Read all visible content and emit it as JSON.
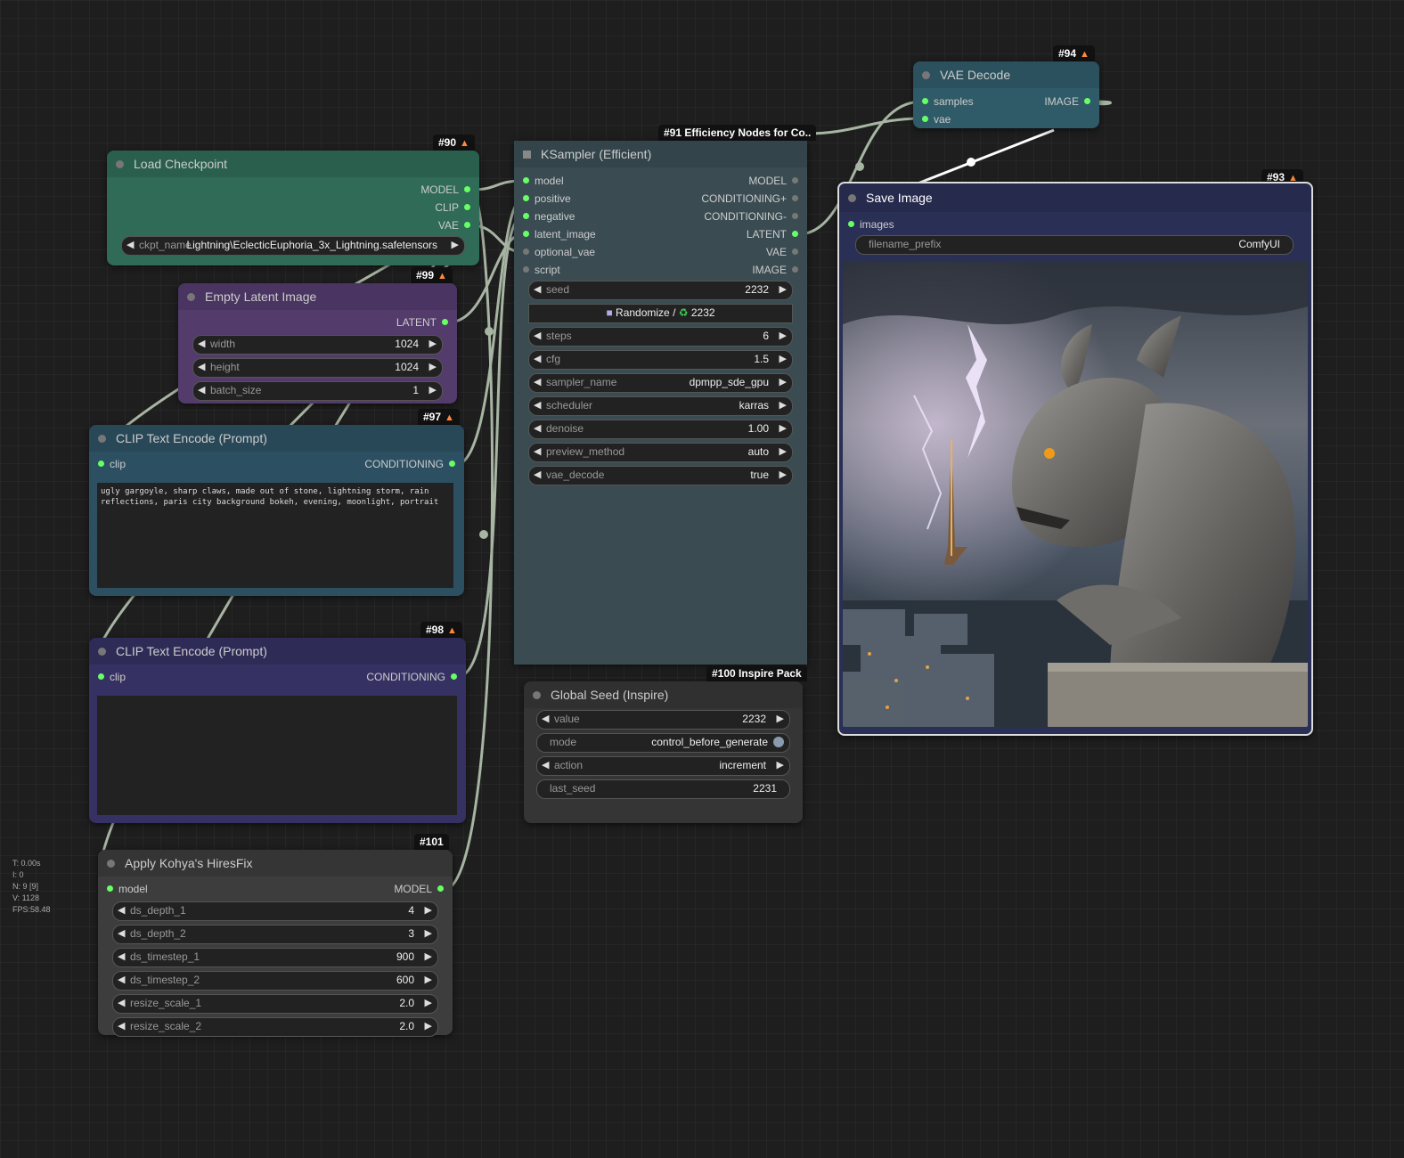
{
  "stats": [
    "T: 0.00s",
    "I: 0",
    "N: 9 [9]",
    "V: 1128",
    "FPS:58.48"
  ],
  "load_checkpoint": {
    "badge": "#90",
    "title": "Load Checkpoint",
    "outputs": [
      "MODEL",
      "CLIP",
      "VAE"
    ],
    "ckpt_label": "ckpt_name",
    "ckpt_value": "Lightning\\EclecticEuphoria_3x_Lightning.safetensors"
  },
  "empty_latent": {
    "badge": "#99",
    "title": "Empty Latent Image",
    "output": "LATENT",
    "widgets": [
      {
        "name": "width",
        "value": "1024"
      },
      {
        "name": "height",
        "value": "1024"
      },
      {
        "name": "batch_size",
        "value": "1"
      }
    ]
  },
  "clip_pos": {
    "badge": "#97",
    "title": "CLIP Text Encode (Prompt)",
    "input": "clip",
    "output": "CONDITIONING",
    "text": "ugly gargoyle, sharp claws, made out of stone, lightning storm, rain\nreflections, paris city background bokeh, evening, moonlight, portrait"
  },
  "clip_neg": {
    "badge": "#98",
    "title": "CLIP Text Encode (Prompt)",
    "input": "clip",
    "output": "CONDITIONING",
    "text": ""
  },
  "hiresfix": {
    "badge": "#101",
    "title": "Apply Kohya's HiresFix",
    "input": "model",
    "output": "MODEL",
    "widgets": [
      {
        "name": "ds_depth_1",
        "value": "4"
      },
      {
        "name": "ds_depth_2",
        "value": "3"
      },
      {
        "name": "ds_timestep_1",
        "value": "900"
      },
      {
        "name": "ds_timestep_2",
        "value": "600"
      },
      {
        "name": "resize_scale_1",
        "value": "2.0"
      },
      {
        "name": "resize_scale_2",
        "value": "2.0"
      }
    ]
  },
  "ksampler": {
    "badge": "#91 Efficiency Nodes for Co..",
    "title": "KSampler (Efficient)",
    "inputs": [
      "model",
      "positive",
      "negative",
      "latent_image",
      "optional_vae",
      "script"
    ],
    "outputs": [
      "MODEL",
      "CONDITIONING+",
      "CONDITIONING-",
      "LATENT",
      "VAE",
      "IMAGE"
    ],
    "seed": {
      "name": "seed",
      "value": "2232"
    },
    "randomize_label": "Randomize / ",
    "randomize_value": "2232",
    "widgets": [
      {
        "name": "steps",
        "value": "6"
      },
      {
        "name": "cfg",
        "value": "1.5"
      },
      {
        "name": "sampler_name",
        "value": "dpmpp_sde_gpu"
      },
      {
        "name": "scheduler",
        "value": "karras"
      },
      {
        "name": "denoise",
        "value": "1.00"
      },
      {
        "name": "preview_method",
        "value": "auto"
      },
      {
        "name": "vae_decode",
        "value": "true"
      }
    ]
  },
  "global_seed": {
    "badge": "#100 Inspire Pack",
    "title": "Global Seed (Inspire)",
    "widgets": [
      {
        "name": "value",
        "value": "2232"
      },
      {
        "name": "mode",
        "value": "control_before_generate"
      },
      {
        "name": "action",
        "value": "increment"
      },
      {
        "name": "last_seed",
        "value": "2231"
      }
    ]
  },
  "vae_decode": {
    "badge": "#94",
    "title": "VAE Decode",
    "inputs": [
      "samples",
      "vae"
    ],
    "output": "IMAGE"
  },
  "save_image": {
    "badge": "#93",
    "title": "Save Image",
    "input": "images",
    "prefix_label": "filename_prefix",
    "prefix_value": "ComfyUI"
  },
  "colors": {
    "canvas": "#1e1e1e",
    "link": "#a7b5a3",
    "pin_active": "#66ff66",
    "checkpoint": "#2f6b57",
    "latent": "#533b6b",
    "clip_pos": "#2c4f62",
    "clip_neg": "#363163",
    "ksampler": "#3a4c52",
    "vae": "#2f5a67",
    "save": "#2a2f55"
  }
}
